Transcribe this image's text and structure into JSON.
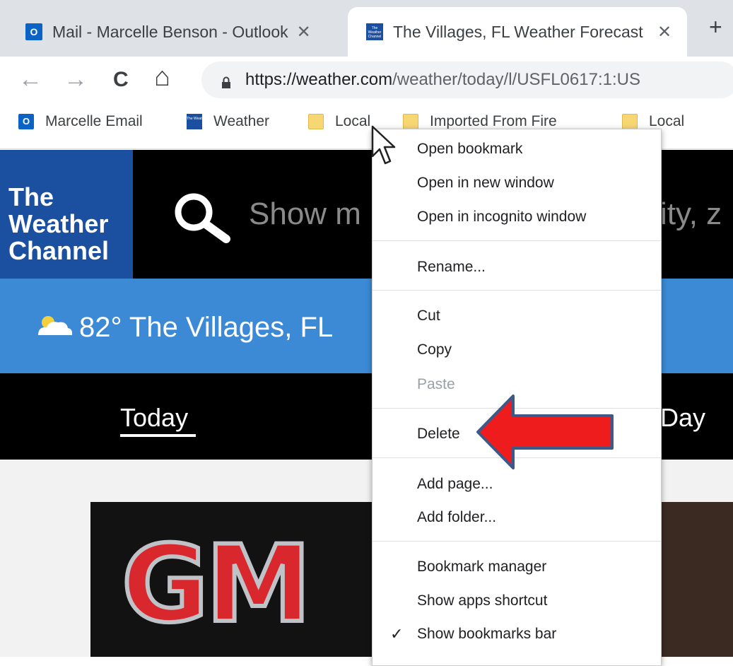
{
  "tabs": [
    {
      "title": "Mail - Marcelle Benson - Outlook",
      "favicon": "outlook-icon",
      "active": false
    },
    {
      "title": "The Villages, FL Weather Forecast",
      "favicon": "weather-channel-icon",
      "active": true
    }
  ],
  "new_tab_label": "+",
  "close_glyph": "✕",
  "favicon_text": {
    "outlook": "O",
    "twc": "The Weather Channel"
  },
  "toolbar": {
    "back": "←",
    "forward": "→",
    "reload": "C",
    "home": "⌂",
    "url_host": "https://weather.com",
    "url_path": "/weather/today/l/USFL0617:1:US"
  },
  "bookmarks": [
    {
      "label": "Marcelle Email",
      "icon": "outlook-icon"
    },
    {
      "label": "Weather",
      "icon": "weather-channel-icon"
    },
    {
      "label": "Local",
      "icon": "folder-icon"
    },
    {
      "label": "Imported From Fire",
      "icon": "folder-icon"
    },
    {
      "label": "Local",
      "icon": "folder-icon"
    }
  ],
  "page": {
    "logo_lines": [
      "The",
      "Weather",
      "Channel"
    ],
    "search_placeholder_left": "Show m",
    "search_placeholder_right": "city, z",
    "temperature": "82°",
    "location": "The Villages, FL",
    "tab_today": "Today",
    "tab_day": "Day",
    "ad_text": "GM"
  },
  "context_menu": {
    "groups": [
      [
        "Open bookmark",
        "Open in new window",
        "Open in incognito window"
      ],
      [
        "Rename..."
      ],
      [
        "Cut",
        "Copy",
        "Paste"
      ],
      [
        "Delete"
      ],
      [
        "Add page...",
        "Add folder..."
      ],
      [
        "Bookmark manager",
        "Show apps shortcut",
        "Show bookmarks bar"
      ]
    ],
    "disabled_item": "Paste",
    "checked_item": "Show bookmarks bar",
    "check_glyph": "✓"
  },
  "colors": {
    "brand_blue": "#1b4fa0",
    "location_bar": "#3c8ad5",
    "arrow_red": "#ee1c1c",
    "arrow_outline": "#3b5a8a"
  }
}
